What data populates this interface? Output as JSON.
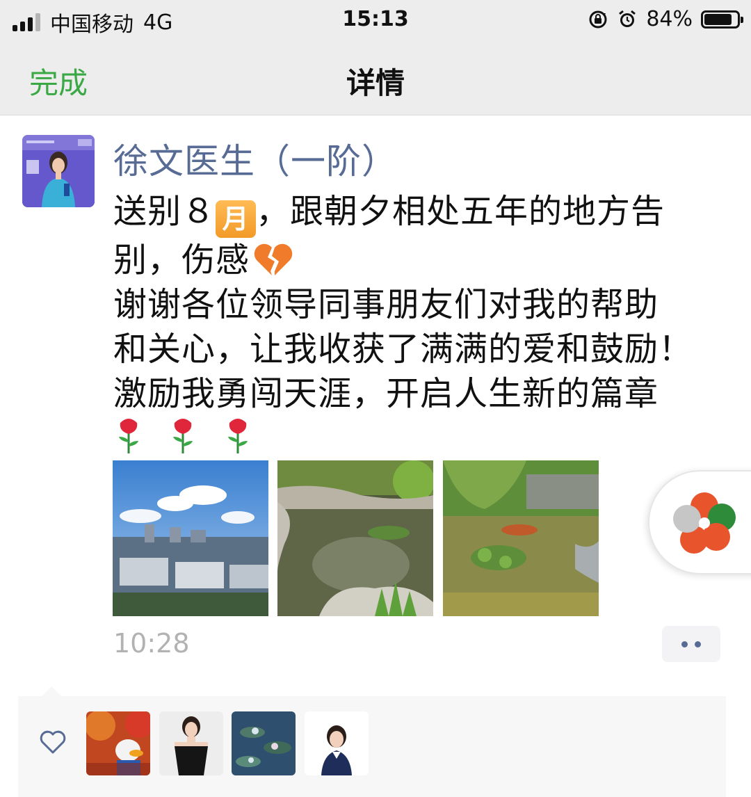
{
  "status_bar": {
    "carrier": "中国移动",
    "network": "4G",
    "time": "15:13",
    "battery_percent": "84%",
    "battery_level": 0.84,
    "icons": [
      "signal-icon",
      "rotation-lock-icon",
      "alarm-icon",
      "battery-icon"
    ]
  },
  "nav": {
    "done_label": "完成",
    "title": "详情"
  },
  "post": {
    "author": "徐文医生（一阶）",
    "text_lines": [
      "送别８",
      "，跟朝夕相处五年的地方告",
      "别，伤感",
      "谢谢各位领导同事朋友们对我的帮助",
      "和关心，让我收获了满满的爱和鼓励！",
      "激励我勇闯天涯，开启人生新的篇章"
    ],
    "month_emoji_label": "月",
    "emojis": [
      "calendar-month-emoji",
      "broken-heart-emoji",
      "rose-emoji",
      "rose-emoji",
      "rose-emoji"
    ],
    "rose_glyphs": [
      "🌹",
      "🌹",
      "🌹"
    ],
    "photos": [
      "city-skyline-photo",
      "garden-pond-photo",
      "koi-pond-photo"
    ],
    "time": "10:28"
  },
  "likes": {
    "icon": "heart-outline-icon",
    "avatars": [
      "donald-duck-avatar",
      "woman-black-dress-avatar",
      "water-lily-avatar",
      "woman-suit-avatar"
    ]
  },
  "colors": {
    "accent_green": "#3aa844",
    "name_blue": "#576b95",
    "nav_bg": "#ededed",
    "time_gray": "#b2b2b2"
  }
}
